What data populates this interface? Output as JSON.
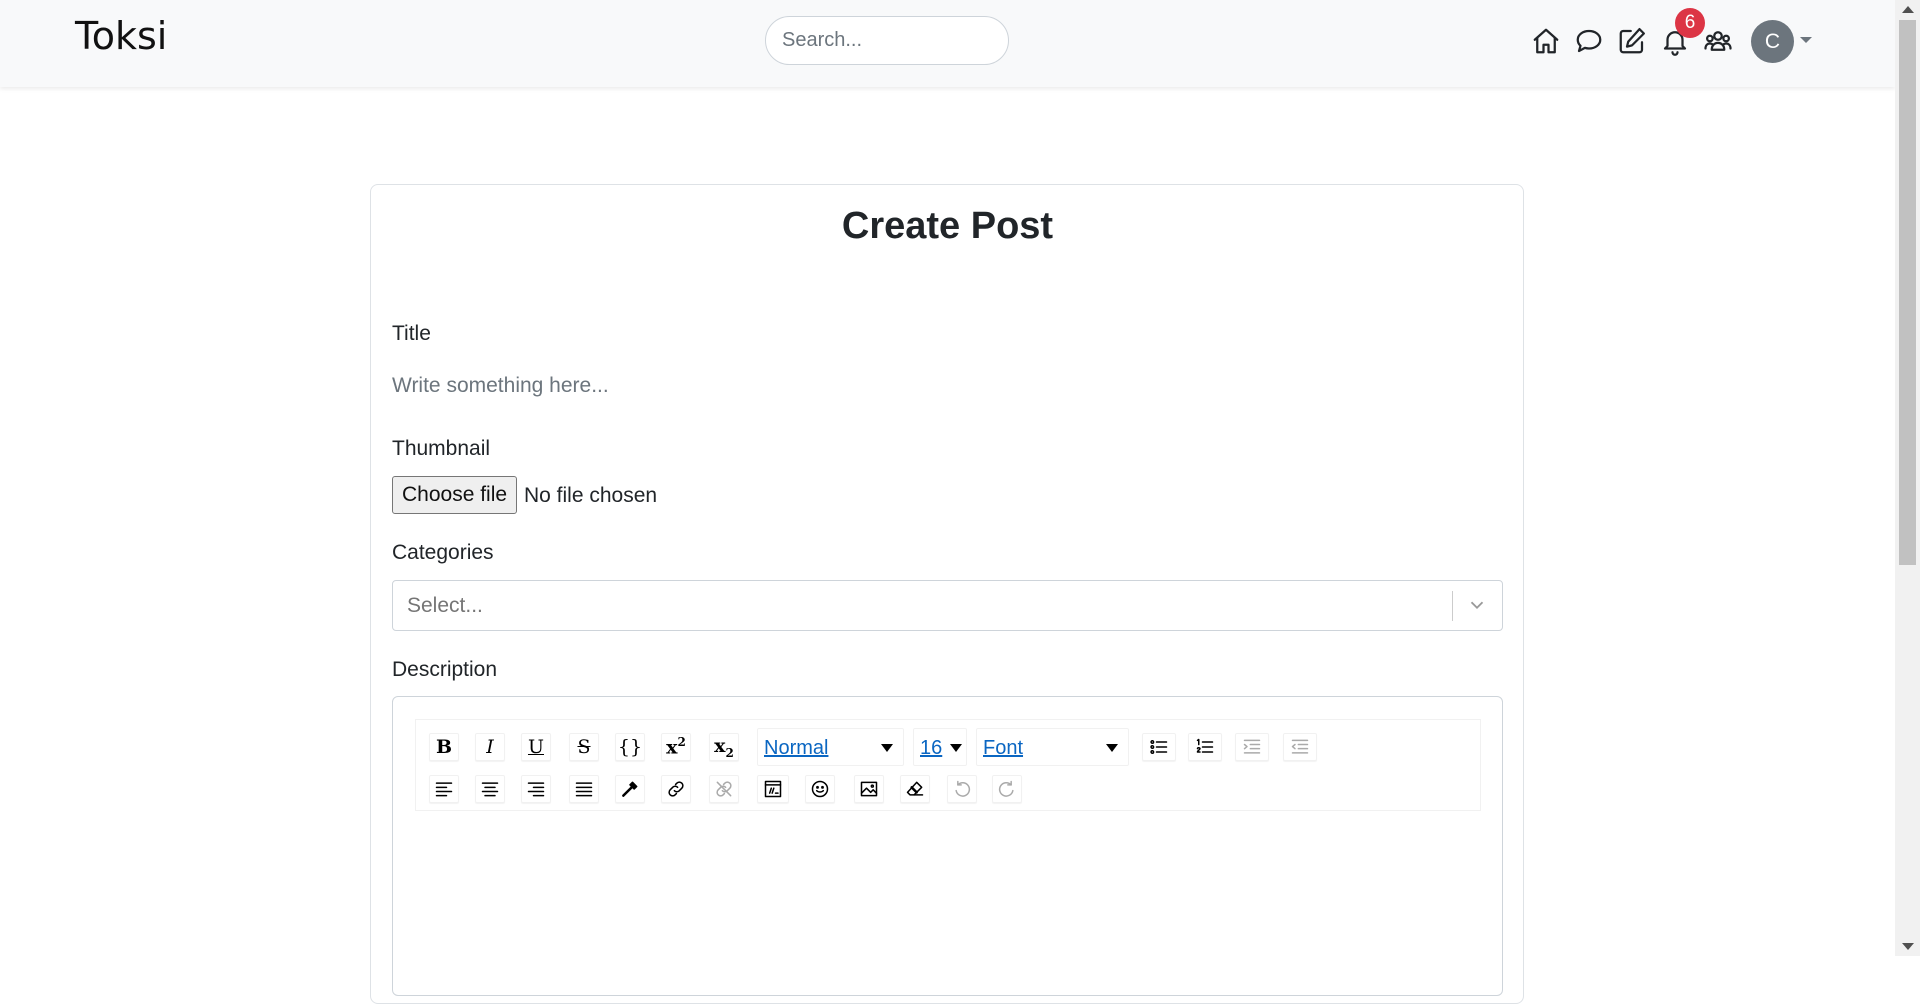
{
  "navbar": {
    "brand": "Toksi",
    "search_placeholder": "Search...",
    "notification_count": "6",
    "avatar_initial": "C"
  },
  "form": {
    "heading": "Create Post",
    "title_label": "Title",
    "title_placeholder": "Write something here...",
    "thumbnail_label": "Thumbnail",
    "choose_file_label": "Choose file",
    "file_status": "No file chosen",
    "categories_label": "Categories",
    "categories_placeholder": "Select...",
    "description_label": "Description"
  },
  "toolbar": {
    "block_type": "Normal",
    "font_size": "16",
    "font_family": "Font",
    "buttons_row1": [
      "bold",
      "italic",
      "underline",
      "strikethrough",
      "code",
      "superscript",
      "subscript",
      "unordered-list",
      "ordered-list",
      "indent",
      "outdent"
    ],
    "buttons_row2": [
      "align-left",
      "align-center",
      "align-right",
      "align-justify",
      "color-picker",
      "link",
      "unlink",
      "embedded",
      "emoji",
      "image",
      "remove-styles",
      "undo",
      "redo"
    ]
  }
}
